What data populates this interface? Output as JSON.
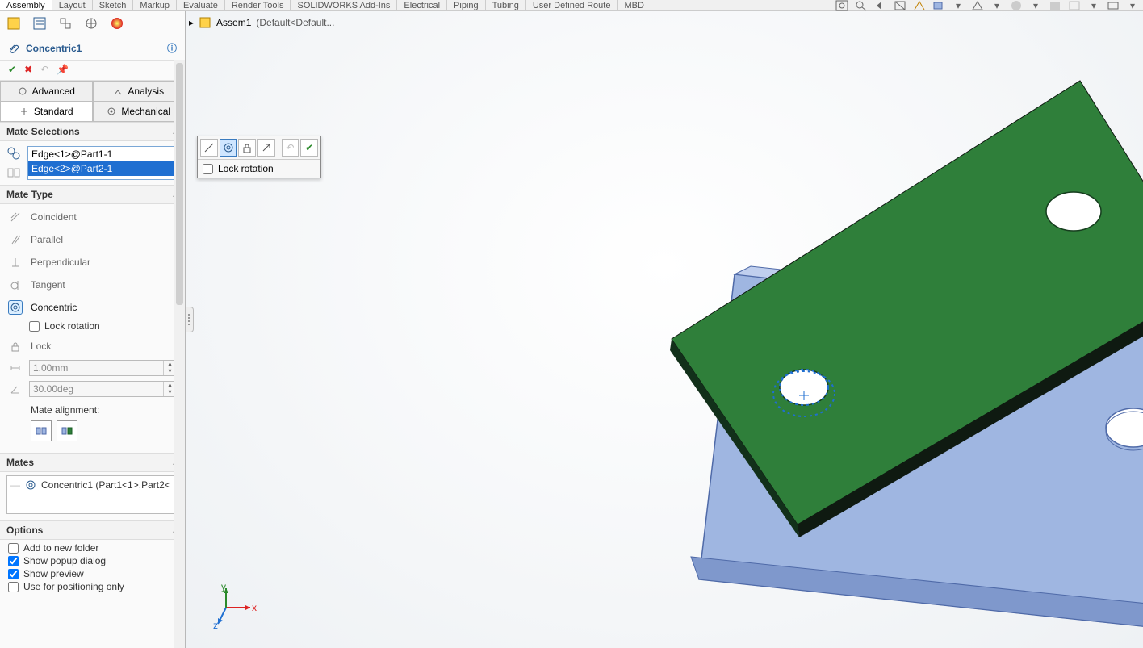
{
  "ribbon": {
    "tabs": [
      "Assembly",
      "Layout",
      "Sketch",
      "Markup",
      "Evaluate",
      "Render Tools",
      "SOLIDWORKS Add-Ins",
      "Electrical",
      "Piping",
      "Tubing",
      "User Defined Route",
      "MBD"
    ],
    "active": 0
  },
  "breadcrumb": {
    "doc": "Assem1",
    "config": "(Default<Default..."
  },
  "side": {
    "feature_title": "Concentric1",
    "tab_row1": {
      "advanced": "Advanced",
      "analysis": "Analysis"
    },
    "tab_row2": {
      "standard": "Standard",
      "mechanical": "Mechanical"
    },
    "active_row1": null,
    "active_row2": "standard"
  },
  "selections": {
    "header": "Mate Selections",
    "items": [
      "Edge<1>@Part1-1",
      "Edge<2>@Part2-1"
    ],
    "selected_index": 1
  },
  "mate_type": {
    "header": "Mate Type",
    "types": [
      "Coincident",
      "Parallel",
      "Perpendicular",
      "Tangent",
      "Concentric",
      "Lock"
    ],
    "active_index": 4,
    "lock_rotation_label": "Lock rotation",
    "lock_rotation_checked": false,
    "distance_value": "1.00mm",
    "angle_value": "30.00deg",
    "alignment_label": "Mate alignment:"
  },
  "mates": {
    "header": "Mates",
    "items": [
      "Concentric1 (Part1<1>,Part2<"
    ]
  },
  "options": {
    "header": "Options",
    "rows": [
      {
        "label": "Add to new folder",
        "checked": false
      },
      {
        "label": "Show popup dialog",
        "checked": true
      },
      {
        "label": "Show preview",
        "checked": true
      },
      {
        "label": "Use for positioning only",
        "checked": false
      }
    ]
  },
  "popup": {
    "lock_rotation_label": "Lock rotation",
    "lock_rotation_checked": false
  },
  "colors": {
    "green": "#2f7f3a",
    "green_side": "#0f1a11",
    "blue": "#9fb6e1",
    "blue_edge": "#4f6aa8",
    "hole_sel": "#1f6fd1"
  }
}
